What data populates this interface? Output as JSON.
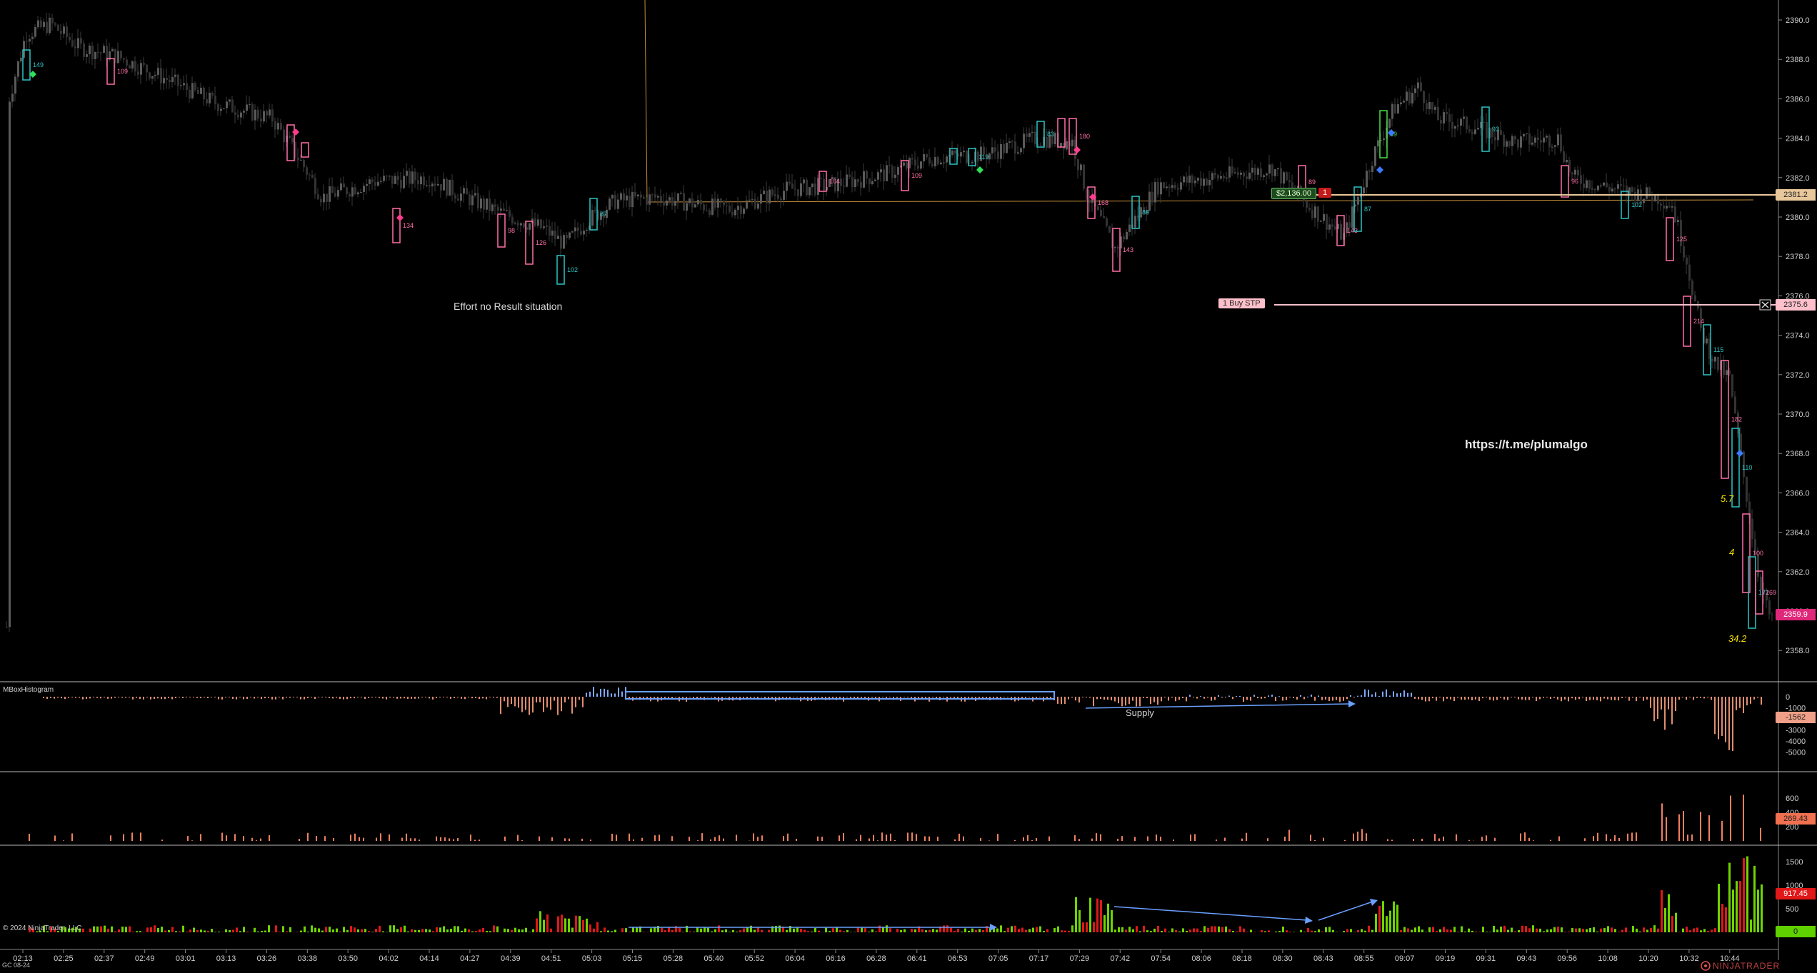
{
  "instrument": "GC 08-24",
  "copyright": "© 2024 NinjaTrader, LLC",
  "brand": "NINJATRADER",
  "watermark_url": "https://t.me/plumalgo",
  "annotations": {
    "effort": "Effort no Result situation",
    "supply": "Supply"
  },
  "panels": {
    "price": {
      "y_ticks": [
        "2390.0",
        "2388.0",
        "2386.0",
        "2384.0",
        "2382.0",
        "2380.0",
        "2378.0",
        "2376.0",
        "2374.0",
        "2372.0",
        "2370.0",
        "2368.0",
        "2366.0",
        "2364.0",
        "2362.0",
        "2360.0",
        "2358.0"
      ],
      "y_range": [
        2357.0,
        2391.0
      ],
      "last_price": "2359.9",
      "position_price": "2381.2",
      "order_price": "2375.6",
      "position_pnl": "$2,136.00",
      "position_qty": "1",
      "order_label": "1  Buy STP"
    },
    "histogram": {
      "title": "MBoxHistogram",
      "y_ticks": [
        "0",
        "-1000",
        "-2000",
        "-3000",
        "-4000",
        "-5000"
      ],
      "current": "-1562"
    },
    "volume_sell": {
      "y_ticks": [
        "600",
        "400",
        "200"
      ],
      "current": "269.43"
    },
    "volume_buy": {
      "y_ticks": [
        "1500",
        "1000",
        "500"
      ],
      "current": "917.45",
      "zero_box": "0"
    }
  },
  "time_axis": [
    "02:13",
    "02:25",
    "02:37",
    "02:49",
    "03:01",
    "03:13",
    "03:26",
    "03:38",
    "03:50",
    "04:02",
    "04:14",
    "04:27",
    "04:39",
    "04:51",
    "05:03",
    "05:15",
    "05:28",
    "05:40",
    "05:52",
    "06:04",
    "06:16",
    "06:28",
    "06:41",
    "06:53",
    "07:05",
    "07:17",
    "07:29",
    "07:42",
    "07:54",
    "08:06",
    "08:18",
    "08:30",
    "08:43",
    "08:55",
    "09:07",
    "09:19",
    "09:31",
    "09:43",
    "09:56",
    "10:08",
    "10:20",
    "10:32",
    "10:44"
  ],
  "colors": {
    "bg": "#000000",
    "candle": "#4a4a4a",
    "teal": "#2ec4c4",
    "pink": "#ff6fa8",
    "green": "#7fd400",
    "red": "#e01818",
    "salmon": "#f08060",
    "blue_note": "#6aa0ff",
    "position_line": "#e8c79a",
    "order_line": "#ffc0cb"
  }
}
